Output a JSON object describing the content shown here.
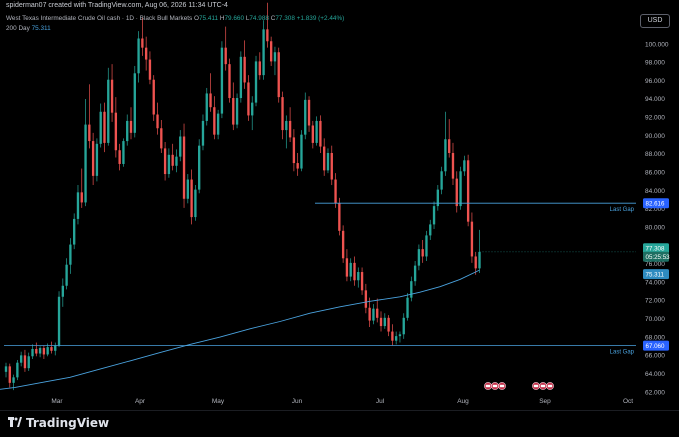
{
  "header": {
    "created_by": "spiderman07 created with TradingView.com, Aug 06, 2026 11:34 UTC-4",
    "currency": "USD"
  },
  "legend": {
    "title": "West Texas Intermediate Crude Oil cash · 1D · Black Bull Markets",
    "o": "75.411",
    "h": "79.660",
    "l": "74.988",
    "c": "77.308",
    "change": "+1.839 (+2.44%)",
    "ma_label": "200 Day",
    "ma_value": "75.311"
  },
  "footer": {
    "brand": "TradingView"
  },
  "chart_data": {
    "type": "candlestick",
    "title": "West Texas Intermediate Crude Oil cash · 1D · Black Bull Markets",
    "x_tick_labels": [
      "Mar",
      "Apr",
      "May",
      "Jun",
      "Jul",
      "Aug",
      "Sep",
      "Oct"
    ],
    "y_tick_labels": [
      "62.000",
      "64.000",
      "66.000",
      "68.000",
      "70.000",
      "72.000",
      "74.000",
      "76.000",
      "78.000",
      "80.000",
      "82.000",
      "84.000",
      "86.000",
      "88.000",
      "90.000",
      "92.000",
      "94.000",
      "96.000",
      "98.000",
      "100.000"
    ],
    "ylim": [
      61.5,
      103
    ],
    "grid": false,
    "price_badges": {
      "last": "77.308",
      "countdown": "05:25:53",
      "ma": "75.311",
      "gap_upper": "82.616",
      "gap_lower": "67.060"
    },
    "horizontal_lines": [
      {
        "label": "Last Gap",
        "value": 82.616
      },
      {
        "label": "Last Gap",
        "value": 67.06
      }
    ],
    "colors": {
      "up": "#26a69a",
      "down": "#ef5350",
      "ma": "#4aa3df",
      "gap": "#4aa3df"
    },
    "ohlc": [
      [
        64.2,
        65.2,
        63.6,
        64.8
      ],
      [
        64.8,
        65.1,
        62.5,
        63.0
      ],
      [
        63.0,
        63.9,
        62.2,
        63.6
      ],
      [
        63.6,
        65.5,
        63.3,
        65.2
      ],
      [
        65.2,
        66.4,
        64.8,
        66.0
      ],
      [
        66.0,
        66.6,
        64.2,
        64.6
      ],
      [
        64.6,
        66.3,
        64.3,
        65.9
      ],
      [
        65.9,
        67.2,
        65.6,
        66.7
      ],
      [
        66.7,
        67.4,
        65.9,
        66.2
      ],
      [
        66.2,
        67.0,
        65.8,
        66.8
      ],
      [
        66.8,
        67.1,
        65.6,
        66.1
      ],
      [
        66.1,
        67.3,
        65.9,
        66.9
      ],
      [
        66.9,
        67.5,
        66.2,
        66.5
      ],
      [
        66.5,
        67.4,
        66.0,
        67.1
      ],
      [
        67.1,
        73.0,
        66.9,
        72.4
      ],
      [
        72.4,
        74.4,
        71.3,
        73.6
      ],
      [
        73.6,
        76.6,
        73.2,
        75.9
      ],
      [
        75.9,
        78.8,
        74.9,
        78.1
      ],
      [
        78.1,
        81.5,
        77.6,
        80.9
      ],
      [
        80.9,
        84.6,
        80.3,
        83.8
      ],
      [
        83.8,
        86.4,
        82.1,
        82.7
      ],
      [
        82.7,
        94.0,
        82.3,
        91.2
      ],
      [
        91.2,
        95.6,
        88.6,
        89.4
      ],
      [
        89.4,
        90.3,
        84.6,
        85.6
      ],
      [
        85.6,
        89.7,
        85.0,
        89.1
      ],
      [
        89.1,
        93.5,
        88.7,
        92.6
      ],
      [
        92.6,
        93.6,
        88.2,
        89.2
      ],
      [
        89.2,
        97.4,
        88.9,
        96.1
      ],
      [
        96.1,
        97.8,
        91.5,
        92.5
      ],
      [
        92.5,
        94.2,
        87.6,
        88.4
      ],
      [
        88.4,
        89.1,
        86.2,
        86.9
      ],
      [
        86.9,
        89.7,
        86.6,
        89.4
      ],
      [
        89.4,
        92.3,
        88.9,
        91.6
      ],
      [
        91.6,
        93.1,
        89.6,
        90.3
      ],
      [
        90.3,
        97.6,
        89.8,
        96.8
      ],
      [
        96.8,
        101.4,
        95.8,
        100.6
      ],
      [
        100.6,
        102.9,
        98.7,
        99.6
      ],
      [
        99.6,
        100.8,
        97.1,
        98.3
      ],
      [
        98.3,
        99.2,
        95.6,
        96.1
      ],
      [
        96.1,
        96.6,
        91.6,
        92.3
      ],
      [
        92.3,
        93.6,
        90.1,
        90.8
      ],
      [
        90.8,
        91.7,
        88.1,
        88.6
      ],
      [
        88.6,
        89.3,
        85.1,
        85.8
      ],
      [
        85.8,
        88.6,
        85.4,
        87.9
      ],
      [
        87.9,
        89.1,
        86.2,
        86.7
      ],
      [
        86.7,
        88.5,
        86.0,
        87.7
      ],
      [
        87.7,
        90.6,
        87.2,
        89.9
      ],
      [
        89.9,
        91.3,
        82.1,
        83.1
      ],
      [
        83.1,
        85.8,
        82.6,
        85.2
      ],
      [
        85.2,
        86.3,
        80.3,
        81.1
      ],
      [
        81.1,
        84.6,
        80.7,
        84.1
      ],
      [
        84.1,
        89.6,
        83.7,
        88.9
      ],
      [
        88.9,
        92.3,
        88.4,
        91.6
      ],
      [
        91.6,
        95.2,
        91.1,
        94.6
      ],
      [
        94.6,
        96.8,
        92.6,
        93.1
      ],
      [
        93.1,
        94.3,
        89.6,
        90.1
      ],
      [
        90.1,
        92.8,
        89.6,
        92.4
      ],
      [
        92.4,
        100.3,
        91.9,
        99.6
      ],
      [
        99.6,
        101.9,
        97.1,
        97.8
      ],
      [
        97.8,
        98.4,
        93.6,
        94.1
      ],
      [
        94.1,
        95.8,
        90.6,
        91.2
      ],
      [
        91.2,
        94.6,
        90.8,
        94.1
      ],
      [
        94.1,
        99.2,
        93.6,
        98.6
      ],
      [
        98.6,
        100.4,
        95.1,
        95.8
      ],
      [
        95.8,
        96.6,
        91.6,
        92.2
      ],
      [
        92.2,
        94.3,
        90.6,
        93.6
      ],
      [
        93.6,
        98.7,
        93.2,
        98.1
      ],
      [
        98.1,
        99.1,
        96.1,
        96.6
      ],
      [
        96.6,
        102.6,
        96.1,
        101.6
      ],
      [
        101.6,
        104.5,
        99.6,
        100.3
      ],
      [
        100.3,
        100.8,
        97.6,
        98.1
      ],
      [
        98.1,
        99.7,
        96.6,
        99.1
      ],
      [
        99.1,
        99.6,
        93.6,
        94.2
      ],
      [
        94.2,
        94.8,
        89.6,
        90.6
      ],
      [
        90.6,
        92.2,
        88.6,
        91.6
      ],
      [
        91.6,
        93.1,
        89.3,
        89.8
      ],
      [
        89.8,
        90.7,
        86.1,
        87.0
      ],
      [
        87.0,
        88.1,
        85.6,
        86.4
      ],
      [
        86.4,
        90.6,
        86.1,
        90.1
      ],
      [
        90.1,
        94.7,
        89.6,
        93.9
      ],
      [
        93.9,
        94.3,
        90.4,
        91.1
      ],
      [
        91.1,
        91.6,
        88.6,
        89.2
      ],
      [
        89.2,
        92.1,
        88.9,
        91.6
      ],
      [
        91.6,
        92.2,
        88.1,
        88.8
      ],
      [
        88.8,
        89.7,
        85.6,
        86.2
      ],
      [
        86.2,
        88.6,
        85.9,
        88.1
      ],
      [
        88.1,
        88.9,
        84.6,
        85.2
      ],
      [
        85.2,
        85.9,
        82.1,
        82.6
      ],
      [
        82.6,
        83.2,
        79.1,
        79.6
      ],
      [
        79.6,
        80.2,
        76.1,
        76.6
      ],
      [
        76.6,
        77.6,
        74.1,
        74.6
      ],
      [
        74.6,
        76.6,
        74.1,
        76.1
      ],
      [
        76.1,
        76.8,
        73.6,
        74.2
      ],
      [
        74.2,
        75.6,
        73.4,
        75.1
      ],
      [
        75.1,
        75.6,
        72.6,
        73.1
      ],
      [
        73.1,
        73.8,
        70.6,
        71.2
      ],
      [
        71.2,
        72.3,
        69.1,
        69.8
      ],
      [
        69.8,
        71.6,
        69.4,
        71.1
      ],
      [
        71.1,
        72.2,
        69.6,
        70.1
      ],
      [
        70.1,
        70.8,
        68.6,
        69.2
      ],
      [
        69.2,
        70.6,
        68.9,
        70.1
      ],
      [
        70.1,
        70.4,
        68.1,
        68.6
      ],
      [
        68.6,
        69.4,
        67.1,
        67.6
      ],
      [
        67.6,
        68.6,
        67.2,
        68.1
      ],
      [
        68.1,
        68.6,
        67.4,
        68.3
      ],
      [
        68.3,
        70.6,
        67.8,
        70.1
      ],
      [
        70.1,
        72.8,
        69.8,
        72.3
      ],
      [
        72.3,
        74.6,
        71.9,
        74.1
      ],
      [
        74.1,
        76.3,
        73.6,
        75.8
      ],
      [
        75.8,
        78.1,
        75.3,
        77.6
      ],
      [
        77.6,
        78.6,
        76.1,
        76.8
      ],
      [
        76.8,
        79.6,
        76.3,
        79.1
      ],
      [
        79.1,
        80.8,
        78.6,
        80.3
      ],
      [
        80.3,
        82.8,
        79.8,
        82.3
      ],
      [
        82.3,
        84.6,
        81.8,
        84.1
      ],
      [
        84.1,
        86.6,
        83.6,
        86.1
      ],
      [
        86.1,
        92.6,
        85.6,
        89.6
      ],
      [
        89.6,
        91.8,
        87.6,
        88.1
      ],
      [
        88.1,
        89.2,
        84.6,
        85.3
      ],
      [
        85.3,
        86.1,
        81.6,
        82.3
      ],
      [
        82.3,
        86.6,
        81.9,
        86.1
      ],
      [
        86.1,
        87.8,
        85.6,
        87.3
      ],
      [
        87.3,
        87.9,
        80.1,
        80.6
      ],
      [
        80.6,
        81.6,
        76.1,
        76.8
      ],
      [
        76.8,
        77.3,
        74.8,
        75.5
      ],
      [
        75.5,
        79.7,
        75.0,
        77.3
      ]
    ]
  }
}
